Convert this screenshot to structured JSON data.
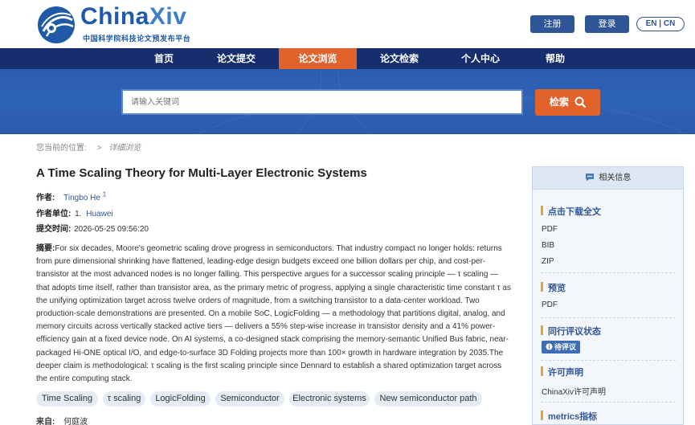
{
  "header": {
    "brand": "ChinaXiv",
    "brand_sub": "中国科学院科技论文预发布平台",
    "register": "注册",
    "login": "登录",
    "lang": "EN | CN"
  },
  "nav": {
    "items": [
      "首页",
      "论文提交",
      "论文浏览",
      "论文检索",
      "个人中心",
      "帮助"
    ],
    "active_index": 2
  },
  "search": {
    "placeholder": "请输入关键词",
    "button": "检索"
  },
  "breadcrumb": {
    "label": "您当前的位置:",
    "sep": ">",
    "current": "详细浏览"
  },
  "article": {
    "title": "A Time Scaling Theory for Multi-Layer Electronic Systems",
    "author_label": "作者:",
    "author": "Tingbo He",
    "author_sup": "1",
    "affil_label": "作者单位:",
    "affil_num": "1.",
    "affil": "Huawei",
    "submit_label": "提交时间:",
    "submit_time": "2026-05-25 09:56:20",
    "abstract_label": "摘要:",
    "abstract": "For six decades, Moore's geometric scaling drove progress in semiconductors. That industry compact no longer holds: returns from pure dimensional shrinking have flattened, leading-edge design budgets exceed one billion dollars per chip, and cost-per-transistor at the most advanced nodes is no longer falling. This perspective argues for a successor scaling principle — τ scaling — that adopts time itself, rather than transistor area, as the primary metric of progress, applying a single characteristic time constant τ as the unifying optimization target across twelve orders of magnitude, from a switching transistor to a data-center workload. Two production-scale demonstrations are presented. On a mobile SoC, LogicFolding — a methodology that partitions digital, analog, and memory circuits across vertically stacked active tiers — delivers a 55% step-wise increase in transistor density and a 41% power-efficiency gain at a fixed device node. On AI systems, a co-designed stack comprising the memory-semantic Unified Bus fabric, near-packaged Hi-ONE optical I/O, and edge-to-surface 3D Folding projects more than 100× growth in hardware integration by 2035.The deeper claim is methodological: τ scaling is the first scaling principle since Dennard to establish a shared optimization target across the entire computing stack.",
    "tags": [
      "Time Scaling",
      "τ scaling",
      "LogicFolding",
      "Semiconductor",
      "Electronic systems",
      "New semiconductor path"
    ],
    "source_label": "来自:",
    "source": "何庭波"
  },
  "sidebar": {
    "head": "相关信息",
    "download_title": "点击下载全文",
    "downloads": [
      "PDF",
      "BIB",
      "ZIP"
    ],
    "preview_title": "预览",
    "preview": "PDF",
    "review_title": "同行评议状态",
    "review_badge": "待评议",
    "license_title": "许可声明",
    "license": "ChinaXiv许可声明",
    "metrics_title": "metrics指标"
  },
  "colors": {
    "brand": "#1e5aa8",
    "nav_bg": "#162e6e",
    "accent": "#e1622b",
    "button": "#2f5597"
  }
}
